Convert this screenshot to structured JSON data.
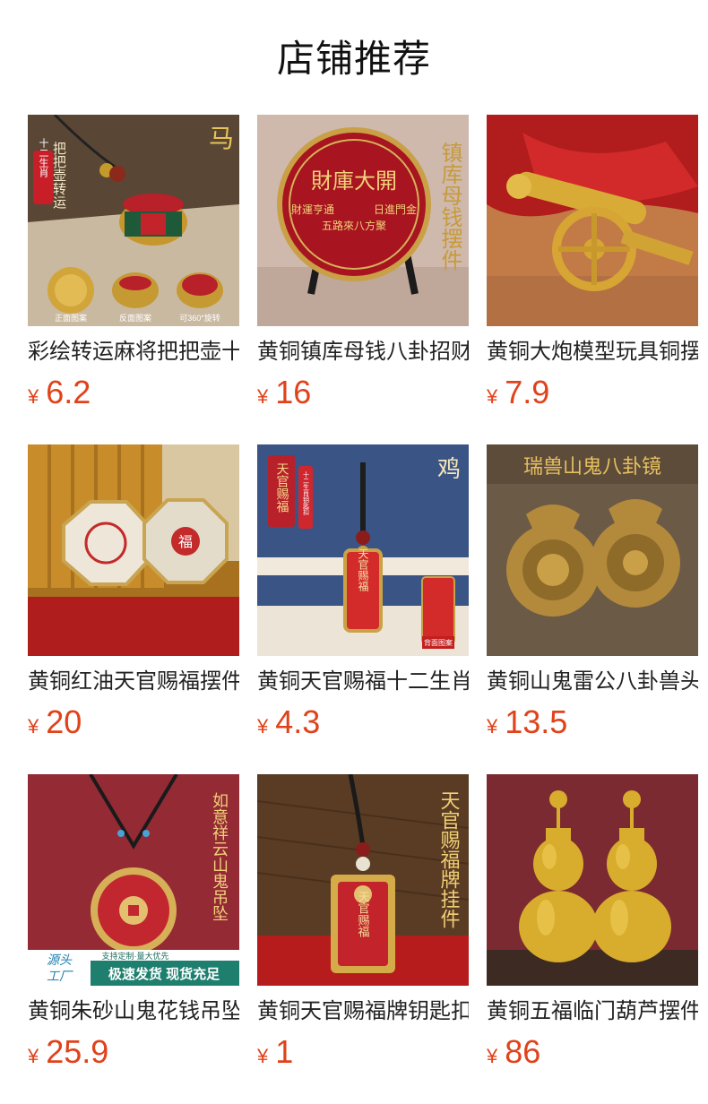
{
  "header": {
    "title": "店铺推荐"
  },
  "currency_symbol": "¥",
  "products": [
    {
      "title": "彩绘转运麻将把把壶十二生肖",
      "price": "6.2",
      "image_text": {
        "corner": "马",
        "badge": "十二生肖",
        "side": "把把壶转运",
        "captions": [
          "正面图案",
          "反面图案",
          "可360°旋转"
        ]
      }
    },
    {
      "title": "黄铜镇库母钱八卦招财摆件",
      "price": "16",
      "image_text": {
        "plate_center": "財庫大開",
        "plate_left": "財運亨通",
        "plate_right": "日進門金",
        "plate_mid": "五路來八方聚",
        "side": "镇库母钱摆件"
      }
    },
    {
      "title": "黄铜大炮模型玩具铜摆件",
      "price": "7.9",
      "image_text": {}
    },
    {
      "title": "黄铜红油天官赐福摆件",
      "price": "20",
      "image_text": {
        "medallion": "福"
      }
    },
    {
      "title": "黄铜天官赐福十二生肖钥匙扣",
      "price": "4.3",
      "image_text": {
        "corner": "鸡",
        "badge_left": "天官赐福",
        "badge_right": "十二生肖钥匙扣",
        "pendant": "天官赐福",
        "caption": "背面图案"
      }
    },
    {
      "title": "黄铜山鬼雷公八卦兽头摆件",
      "price": "13.5",
      "image_text": {
        "banner": "瑞兽山鬼八卦镜"
      }
    },
    {
      "title": "黄铜朱砂山鬼花钱吊坠",
      "price": "25.9",
      "image_text": {
        "side": "如意祥云山鬼吊坠",
        "source_top": "源头",
        "source_bottom": "工厂",
        "promo_top": "支持定制·量大优先",
        "promo_bottom": "极速发货 现货充足"
      }
    },
    {
      "title": "黄铜天官赐福牌钥匙扣挂件",
      "price": "1",
      "image_text": {
        "side": "天官赐福牌挂件",
        "pendant": "天官赐福"
      }
    },
    {
      "title": "黄铜五福临门葫芦摆件",
      "price": "86",
      "image_text": {}
    }
  ]
}
